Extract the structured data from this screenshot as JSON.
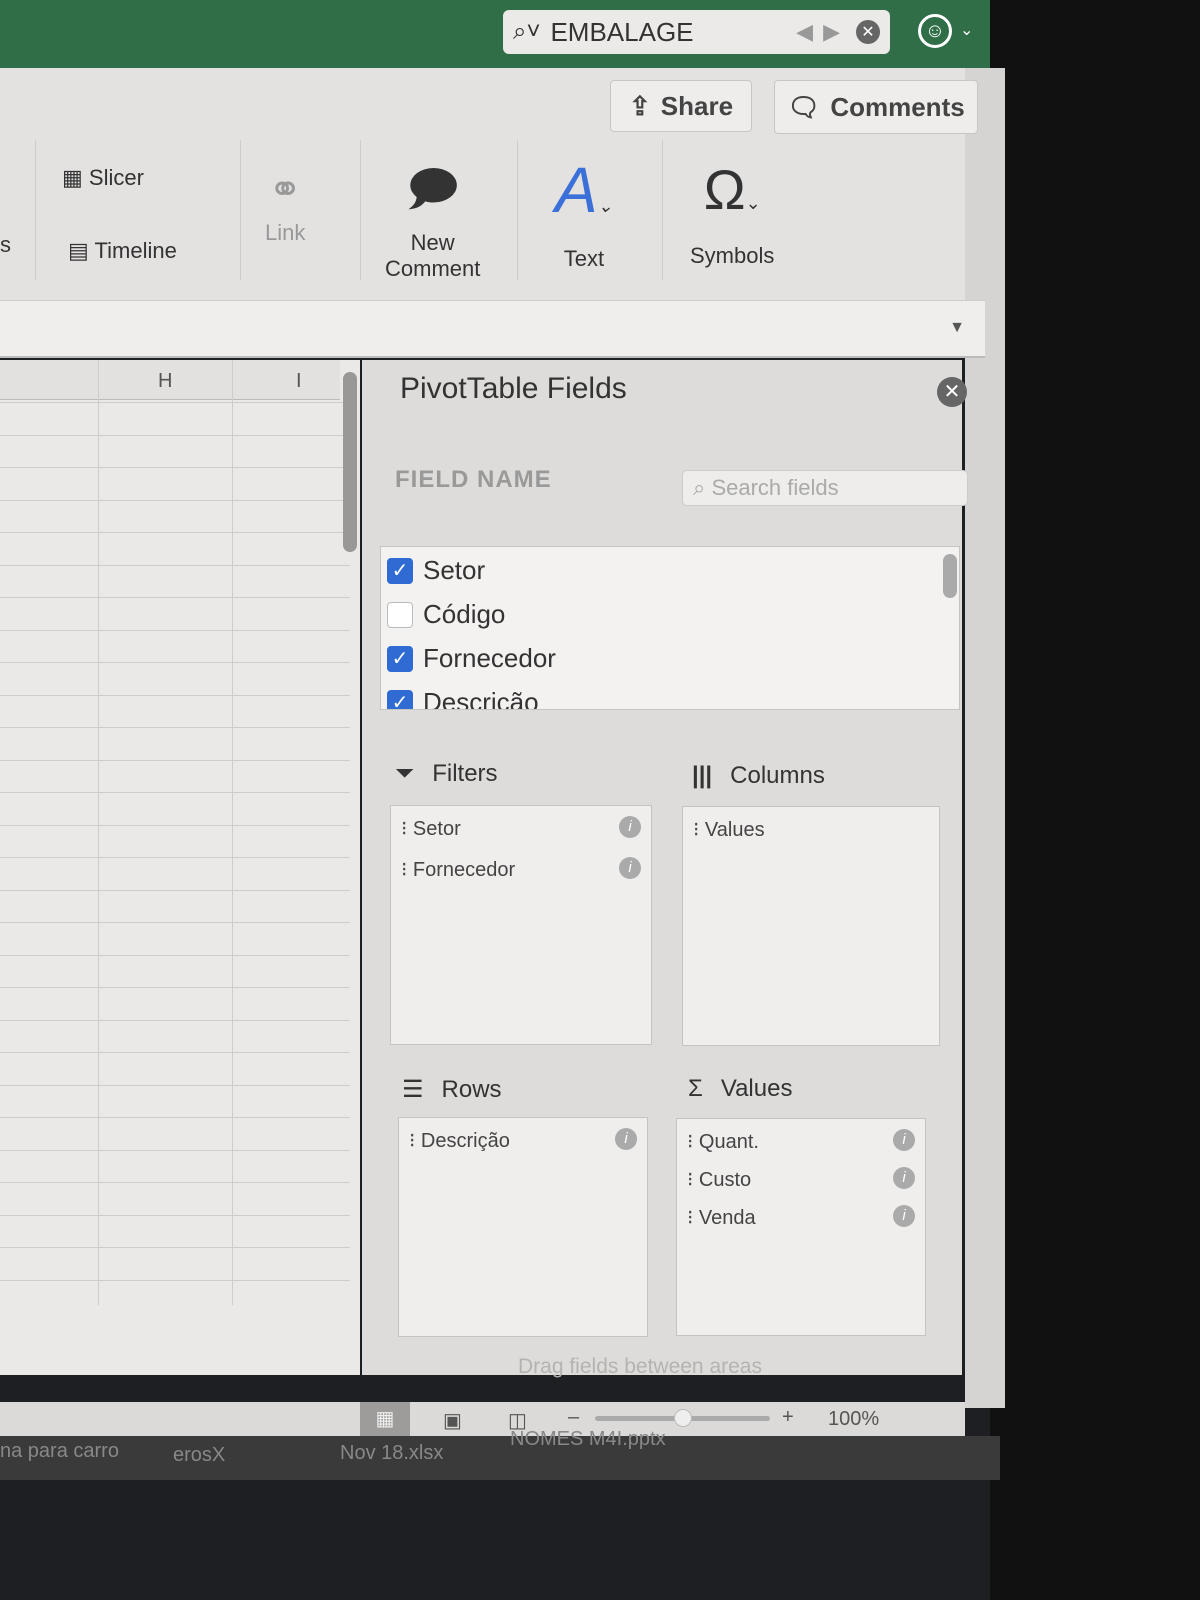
{
  "titlebar": {
    "search_value": "EMBALAGE"
  },
  "ribbon": {
    "share": "Share",
    "comments": "Comments",
    "slicer": "Slicer",
    "timeline": "Timeline",
    "link": "Link",
    "new_comment_1": "New",
    "new_comment_2": "Comment",
    "text": "Text",
    "symbols": "Symbols",
    "cut_label": "s"
  },
  "grid": {
    "col_h": "H",
    "col_i": "I"
  },
  "pivot": {
    "title": "PivotTable Fields",
    "field_name": "FIELD NAME",
    "search_placeholder": "Search fields",
    "fields": [
      {
        "label": "Setor",
        "checked": true
      },
      {
        "label": "Código",
        "checked": false
      },
      {
        "label": "Fornecedor",
        "checked": true
      },
      {
        "label": "Descrição",
        "checked": true
      }
    ],
    "filters": {
      "label": "Filters",
      "items": [
        "Setor",
        "Fornecedor"
      ]
    },
    "columns": {
      "label": "Columns",
      "items": [
        "Values"
      ]
    },
    "rows": {
      "label": "Rows",
      "items": [
        "Descrição"
      ]
    },
    "values": {
      "label": "Values",
      "items": [
        "Quant.",
        "Custo",
        "Venda"
      ]
    },
    "drag_hint": "Drag fields between areas"
  },
  "status": {
    "zoom": "100%",
    "zoom_level": 0.5
  },
  "dock": {
    "items": [
      "na para carro",
      "erosX",
      "Nov 18.xlsx",
      "NOMES M4I.pptx"
    ]
  }
}
